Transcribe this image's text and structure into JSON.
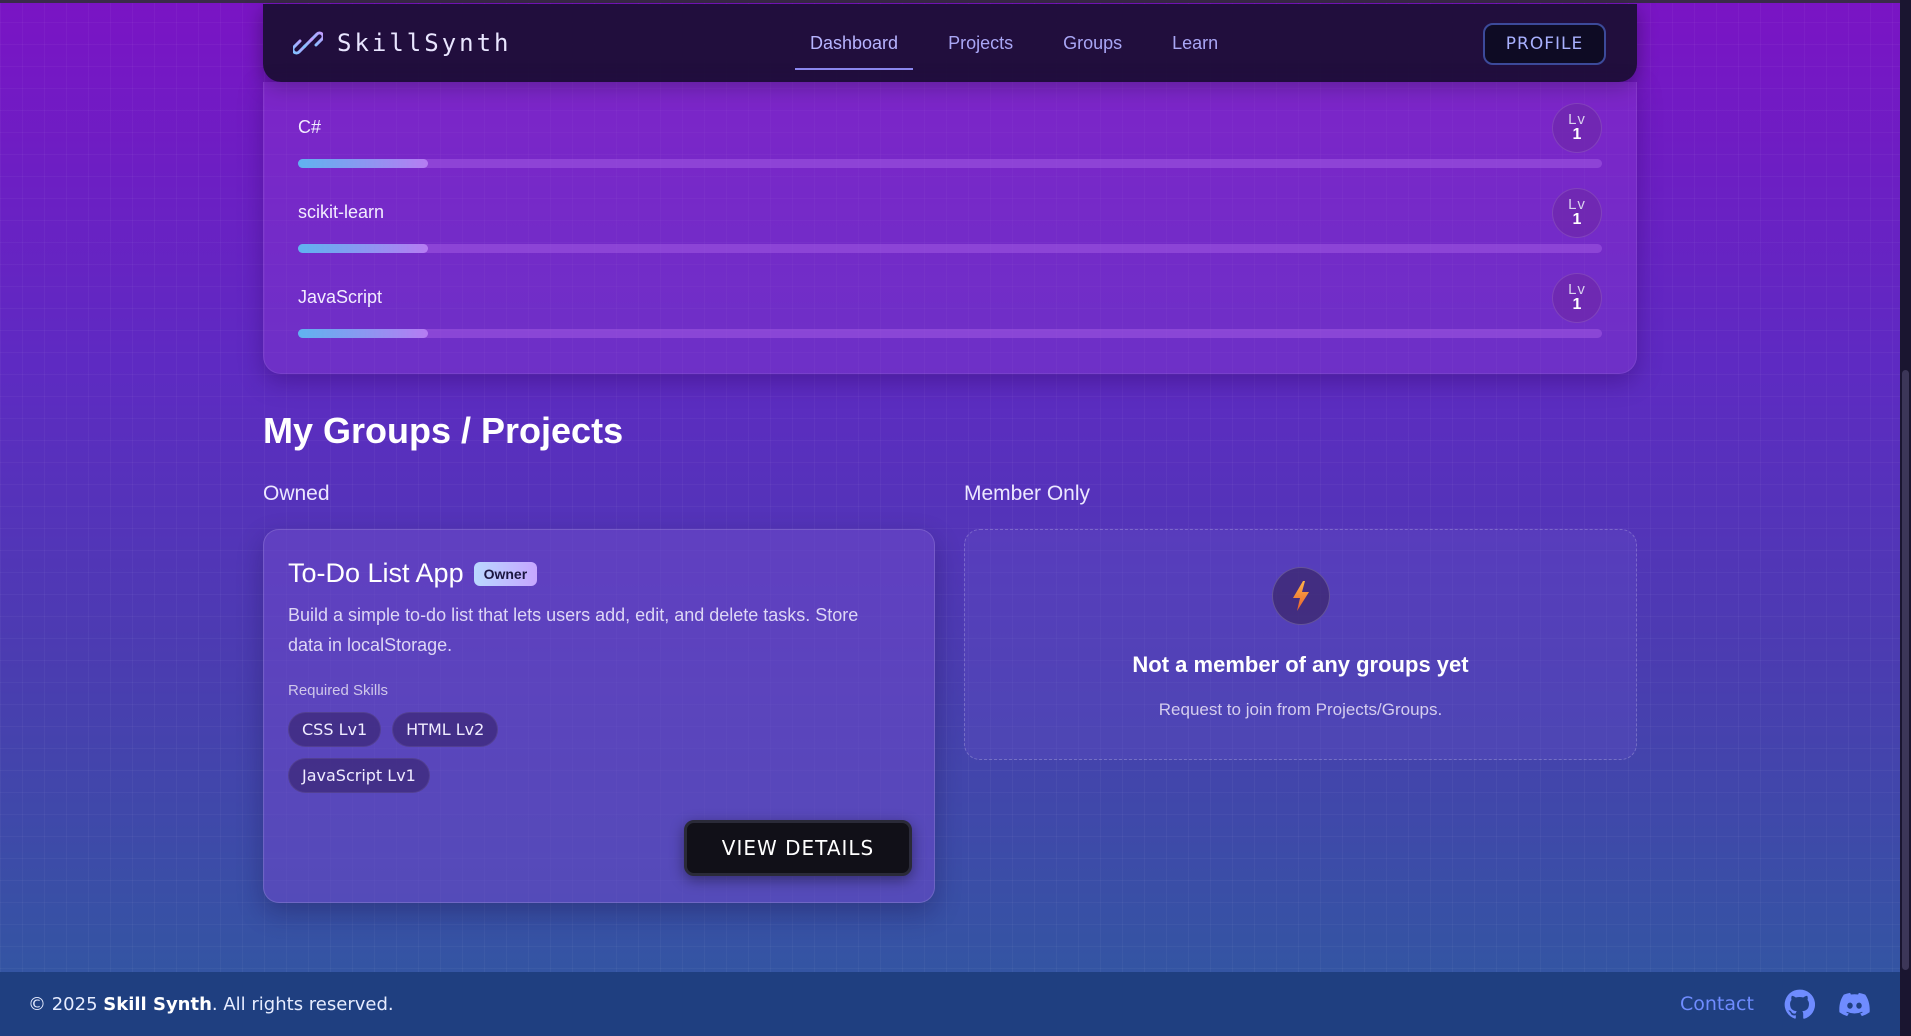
{
  "brand": {
    "name": "SkillSynth"
  },
  "nav": {
    "links": [
      {
        "label": "Dashboard",
        "active": true
      },
      {
        "label": "Projects",
        "active": false
      },
      {
        "label": "Groups",
        "active": false
      },
      {
        "label": "Learn",
        "active": false
      }
    ],
    "profile_label": "PROFILE"
  },
  "skills": [
    {
      "name": "C#",
      "level_label": "Lv",
      "level": "1",
      "progress_fraction": 0.1
    },
    {
      "name": "scikit-learn",
      "level_label": "Lv",
      "level": "1",
      "progress_fraction": 0.1
    },
    {
      "name": "JavaScript",
      "level_label": "Lv",
      "level": "1",
      "progress_fraction": 0.1
    }
  ],
  "section": {
    "title": "My Groups / Projects",
    "owned_label": "Owned",
    "member_label": "Member Only"
  },
  "owned_project": {
    "title": "To-Do List App",
    "badge": "Owner",
    "description": "Build a simple to-do list that lets users add, edit, and delete tasks. Store data in localStorage.",
    "required_label": "Required Skills",
    "skills": [
      "CSS Lv1",
      "HTML Lv2",
      "JavaScript Lv1"
    ],
    "button_label": "VIEW DETAILS"
  },
  "member_empty": {
    "icon": "lightning-bolt-icon",
    "title": "Not a member of any groups yet",
    "subtitle": "Request to join from Projects/Groups."
  },
  "footer": {
    "copyright_prefix": "© 2025 ",
    "copyright_brand": "Skill Synth",
    "copyright_suffix": ". All rights reserved.",
    "contact_label": "Contact",
    "icons": [
      "github-icon",
      "discord-icon"
    ]
  },
  "colors": {
    "accent": "#8d89f0",
    "bar_start": "#5fb3f0",
    "bar_end": "#b67cf2",
    "footer_bg": "#1f3f80",
    "bolt": "#f08a3c"
  }
}
